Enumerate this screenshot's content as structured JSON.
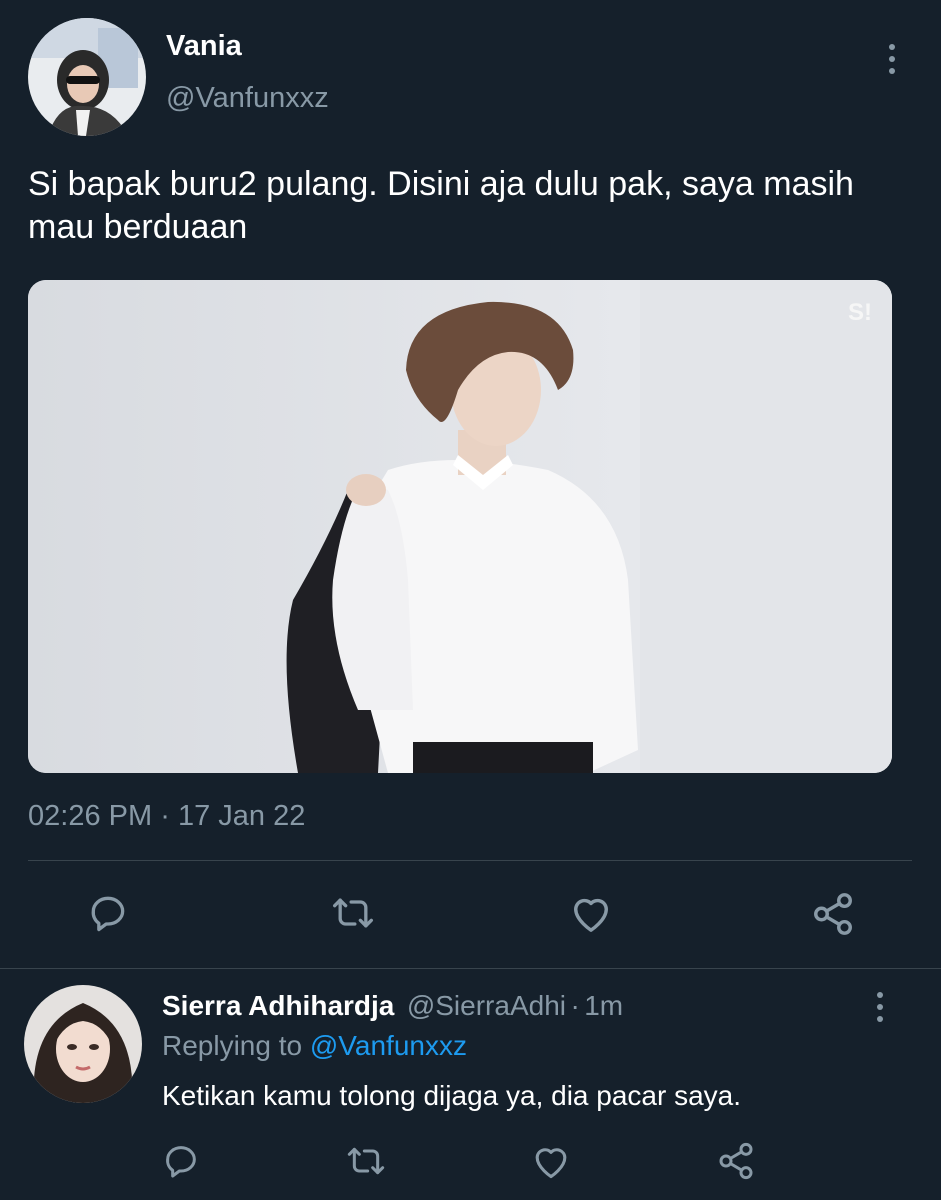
{
  "tweet": {
    "author": {
      "name": "Vania",
      "handle": "@Vanfunxxz"
    },
    "text": "Si bapak buru2 pulang. Disini aja dulu pak, saya masih mau berduaan",
    "media": {
      "watermark": "S!"
    },
    "time": "02:26 PM",
    "separator": "·",
    "date": "17 Jan 22",
    "actions": [
      "reply-icon",
      "retweet-icon",
      "like-icon",
      "share-icon"
    ],
    "more_icon": "more-vertical-icon"
  },
  "reply": {
    "author": {
      "name": "Sierra Adhihardja",
      "handle": "@SierraAdhi",
      "separator": "·",
      "age": "1m"
    },
    "replying_prefix": "Replying to",
    "replying_to": "@Vanfunxxz",
    "text": "Ketikan kamu tolong dijaga ya, dia pacar saya.",
    "actions": [
      "reply-icon",
      "retweet-icon",
      "like-icon",
      "share-icon"
    ],
    "more_icon": "more-vertical-icon"
  },
  "colors": {
    "background": "#15202b",
    "secondary_text": "#8899a6",
    "divider": "#38444d",
    "link": "#1d9bf0"
  }
}
